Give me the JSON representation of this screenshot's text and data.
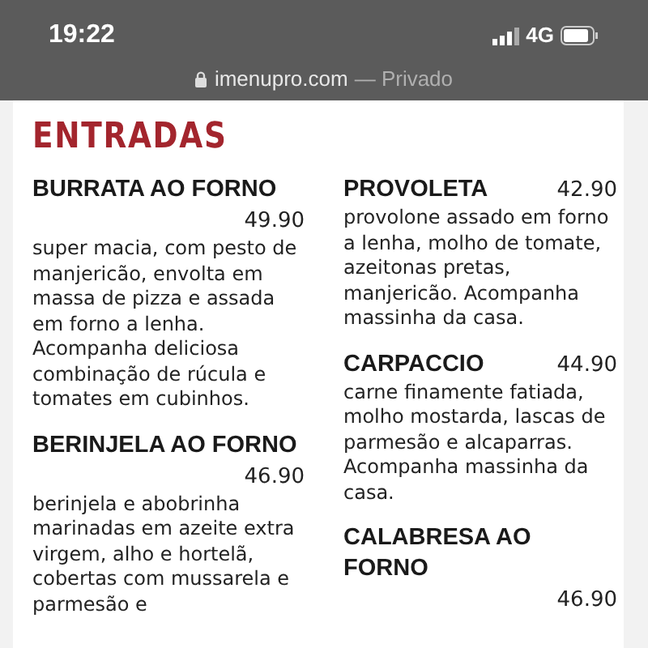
{
  "status_bar": {
    "time": "19:22",
    "network": "4G"
  },
  "address_bar": {
    "domain": "imenupro.com",
    "suffix": "— Privado"
  },
  "section": {
    "title": "ENTRADAS"
  },
  "columns": [
    [
      {
        "name": "BURRATA AO FORNO",
        "price": "49.90",
        "description": "super macia, com pesto de manjericão, envolta em massa de pizza e assada em forno a lenha. Acompanha deliciosa combinação de rúcula e tomates em cubinhos."
      },
      {
        "name": "BERINJELA AO FORNO",
        "price": "46.90",
        "description": "berinjela e abobrinha marinadas em azeite extra virgem, alho e hortelã, cobertas com mussarela e parmesão e"
      }
    ],
    [
      {
        "name": "PROVOLETA",
        "price": "42.90",
        "description": "provolone assado em forno a lenha, molho de tomate, azeitonas pretas, manjericão. Acompanha massinha da casa."
      },
      {
        "name": "CARPACCIO",
        "price": "44.90",
        "description": "carne finamente fatiada, molho mostarda, lascas de parmesão e alcaparras. Acompanha massinha da casa."
      },
      {
        "name": "CALABRESA AO FORNO",
        "price": "46.90"
      }
    ]
  ]
}
